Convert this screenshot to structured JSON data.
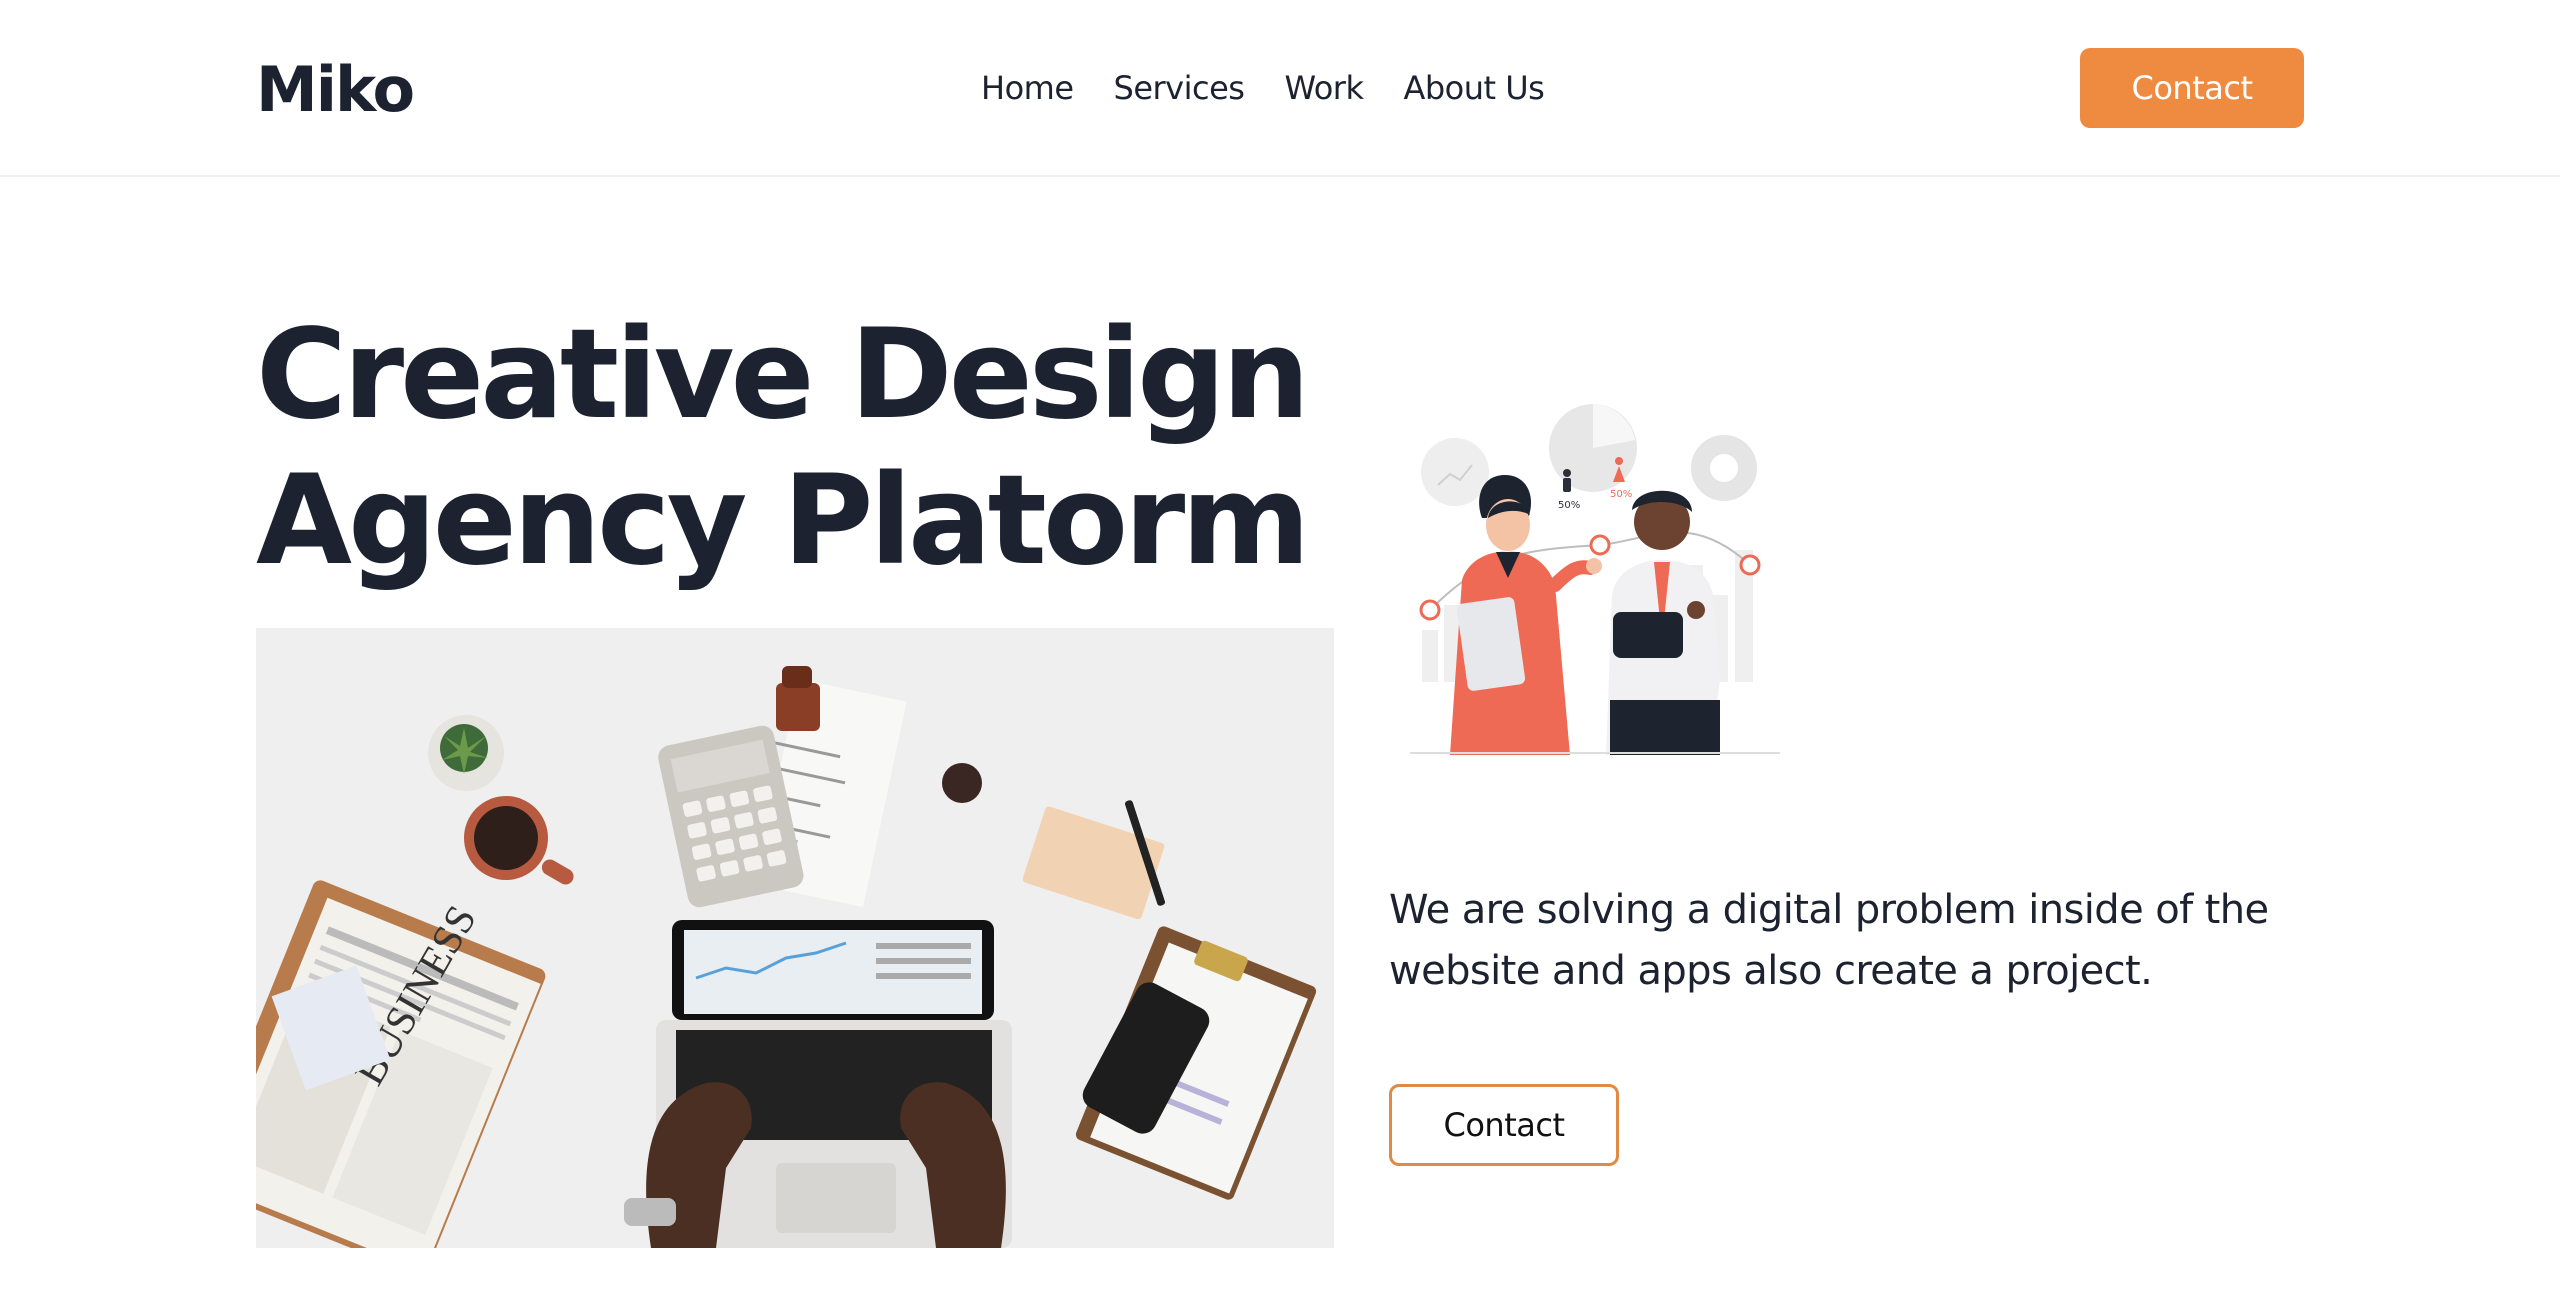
{
  "header": {
    "logo": "Miko",
    "nav": [
      "Home",
      "Services",
      "Work",
      "About Us"
    ],
    "contact_label": "Contact"
  },
  "hero": {
    "title_line1": "Creative Design",
    "title_line2": "Agency Platorm",
    "description": "We are solving a digital problem inside of the website and apps also create a project.",
    "contact_label": "Contact",
    "illustration_labels": [
      "50%",
      "50%"
    ]
  },
  "colors": {
    "accent": "#ee8b41",
    "text": "#1c2230",
    "illustration_red": "#ee6a55"
  },
  "icons": [
    "workspace-photo",
    "team-analytics-illustration"
  ]
}
